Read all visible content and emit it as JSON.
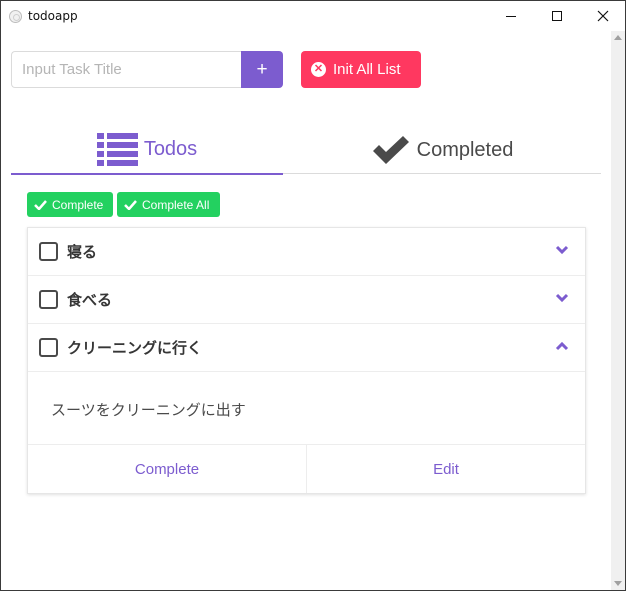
{
  "window": {
    "title": "todoapp",
    "controls": [
      "minimize-icon",
      "maximize-icon",
      "close-icon"
    ]
  },
  "form": {
    "input_placeholder": "Input Task Title",
    "input_value": "",
    "add_label": "+",
    "init_label": "Init All List"
  },
  "tabs": [
    {
      "label": "Todos",
      "icon": "list-icon",
      "active": true
    },
    {
      "label": "Completed",
      "icon": "checkmark-icon",
      "active": false
    }
  ],
  "actions": {
    "complete_label": "Complete",
    "complete_all_label": "Complete All"
  },
  "todos": [
    {
      "title": "寝る",
      "checked": false,
      "expanded": false
    },
    {
      "title": "食べる",
      "checked": false,
      "expanded": false
    },
    {
      "title": "クリーニングに行く",
      "checked": false,
      "expanded": true,
      "detail": "スーツをクリーニングに出す"
    }
  ],
  "card_footer": {
    "complete_label": "Complete",
    "edit_label": "Edit"
  },
  "colors": {
    "primary": "#7c5ccf",
    "danger": "#ff3860",
    "success": "#23d160",
    "text": "#363636"
  }
}
